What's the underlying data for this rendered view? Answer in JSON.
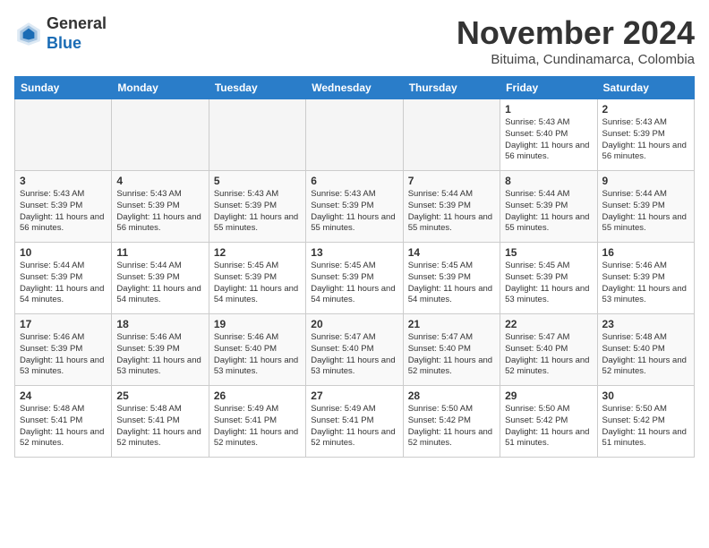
{
  "header": {
    "logo_line1": "General",
    "logo_line2": "Blue",
    "month_title": "November 2024",
    "location": "Bituima, Cundinamarca, Colombia"
  },
  "days_of_week": [
    "Sunday",
    "Monday",
    "Tuesday",
    "Wednesday",
    "Thursday",
    "Friday",
    "Saturday"
  ],
  "weeks": [
    [
      {
        "day": "",
        "info": ""
      },
      {
        "day": "",
        "info": ""
      },
      {
        "day": "",
        "info": ""
      },
      {
        "day": "",
        "info": ""
      },
      {
        "day": "",
        "info": ""
      },
      {
        "day": "1",
        "info": "Sunrise: 5:43 AM\nSunset: 5:40 PM\nDaylight: 11 hours and 56 minutes."
      },
      {
        "day": "2",
        "info": "Sunrise: 5:43 AM\nSunset: 5:39 PM\nDaylight: 11 hours and 56 minutes."
      }
    ],
    [
      {
        "day": "3",
        "info": "Sunrise: 5:43 AM\nSunset: 5:39 PM\nDaylight: 11 hours and 56 minutes."
      },
      {
        "day": "4",
        "info": "Sunrise: 5:43 AM\nSunset: 5:39 PM\nDaylight: 11 hours and 56 minutes."
      },
      {
        "day": "5",
        "info": "Sunrise: 5:43 AM\nSunset: 5:39 PM\nDaylight: 11 hours and 55 minutes."
      },
      {
        "day": "6",
        "info": "Sunrise: 5:43 AM\nSunset: 5:39 PM\nDaylight: 11 hours and 55 minutes."
      },
      {
        "day": "7",
        "info": "Sunrise: 5:44 AM\nSunset: 5:39 PM\nDaylight: 11 hours and 55 minutes."
      },
      {
        "day": "8",
        "info": "Sunrise: 5:44 AM\nSunset: 5:39 PM\nDaylight: 11 hours and 55 minutes."
      },
      {
        "day": "9",
        "info": "Sunrise: 5:44 AM\nSunset: 5:39 PM\nDaylight: 11 hours and 55 minutes."
      }
    ],
    [
      {
        "day": "10",
        "info": "Sunrise: 5:44 AM\nSunset: 5:39 PM\nDaylight: 11 hours and 54 minutes."
      },
      {
        "day": "11",
        "info": "Sunrise: 5:44 AM\nSunset: 5:39 PM\nDaylight: 11 hours and 54 minutes."
      },
      {
        "day": "12",
        "info": "Sunrise: 5:45 AM\nSunset: 5:39 PM\nDaylight: 11 hours and 54 minutes."
      },
      {
        "day": "13",
        "info": "Sunrise: 5:45 AM\nSunset: 5:39 PM\nDaylight: 11 hours and 54 minutes."
      },
      {
        "day": "14",
        "info": "Sunrise: 5:45 AM\nSunset: 5:39 PM\nDaylight: 11 hours and 54 minutes."
      },
      {
        "day": "15",
        "info": "Sunrise: 5:45 AM\nSunset: 5:39 PM\nDaylight: 11 hours and 53 minutes."
      },
      {
        "day": "16",
        "info": "Sunrise: 5:46 AM\nSunset: 5:39 PM\nDaylight: 11 hours and 53 minutes."
      }
    ],
    [
      {
        "day": "17",
        "info": "Sunrise: 5:46 AM\nSunset: 5:39 PM\nDaylight: 11 hours and 53 minutes."
      },
      {
        "day": "18",
        "info": "Sunrise: 5:46 AM\nSunset: 5:39 PM\nDaylight: 11 hours and 53 minutes."
      },
      {
        "day": "19",
        "info": "Sunrise: 5:46 AM\nSunset: 5:40 PM\nDaylight: 11 hours and 53 minutes."
      },
      {
        "day": "20",
        "info": "Sunrise: 5:47 AM\nSunset: 5:40 PM\nDaylight: 11 hours and 53 minutes."
      },
      {
        "day": "21",
        "info": "Sunrise: 5:47 AM\nSunset: 5:40 PM\nDaylight: 11 hours and 52 minutes."
      },
      {
        "day": "22",
        "info": "Sunrise: 5:47 AM\nSunset: 5:40 PM\nDaylight: 11 hours and 52 minutes."
      },
      {
        "day": "23",
        "info": "Sunrise: 5:48 AM\nSunset: 5:40 PM\nDaylight: 11 hours and 52 minutes."
      }
    ],
    [
      {
        "day": "24",
        "info": "Sunrise: 5:48 AM\nSunset: 5:41 PM\nDaylight: 11 hours and 52 minutes."
      },
      {
        "day": "25",
        "info": "Sunrise: 5:48 AM\nSunset: 5:41 PM\nDaylight: 11 hours and 52 minutes."
      },
      {
        "day": "26",
        "info": "Sunrise: 5:49 AM\nSunset: 5:41 PM\nDaylight: 11 hours and 52 minutes."
      },
      {
        "day": "27",
        "info": "Sunrise: 5:49 AM\nSunset: 5:41 PM\nDaylight: 11 hours and 52 minutes."
      },
      {
        "day": "28",
        "info": "Sunrise: 5:50 AM\nSunset: 5:42 PM\nDaylight: 11 hours and 52 minutes."
      },
      {
        "day": "29",
        "info": "Sunrise: 5:50 AM\nSunset: 5:42 PM\nDaylight: 11 hours and 51 minutes."
      },
      {
        "day": "30",
        "info": "Sunrise: 5:50 AM\nSunset: 5:42 PM\nDaylight: 11 hours and 51 minutes."
      }
    ]
  ]
}
